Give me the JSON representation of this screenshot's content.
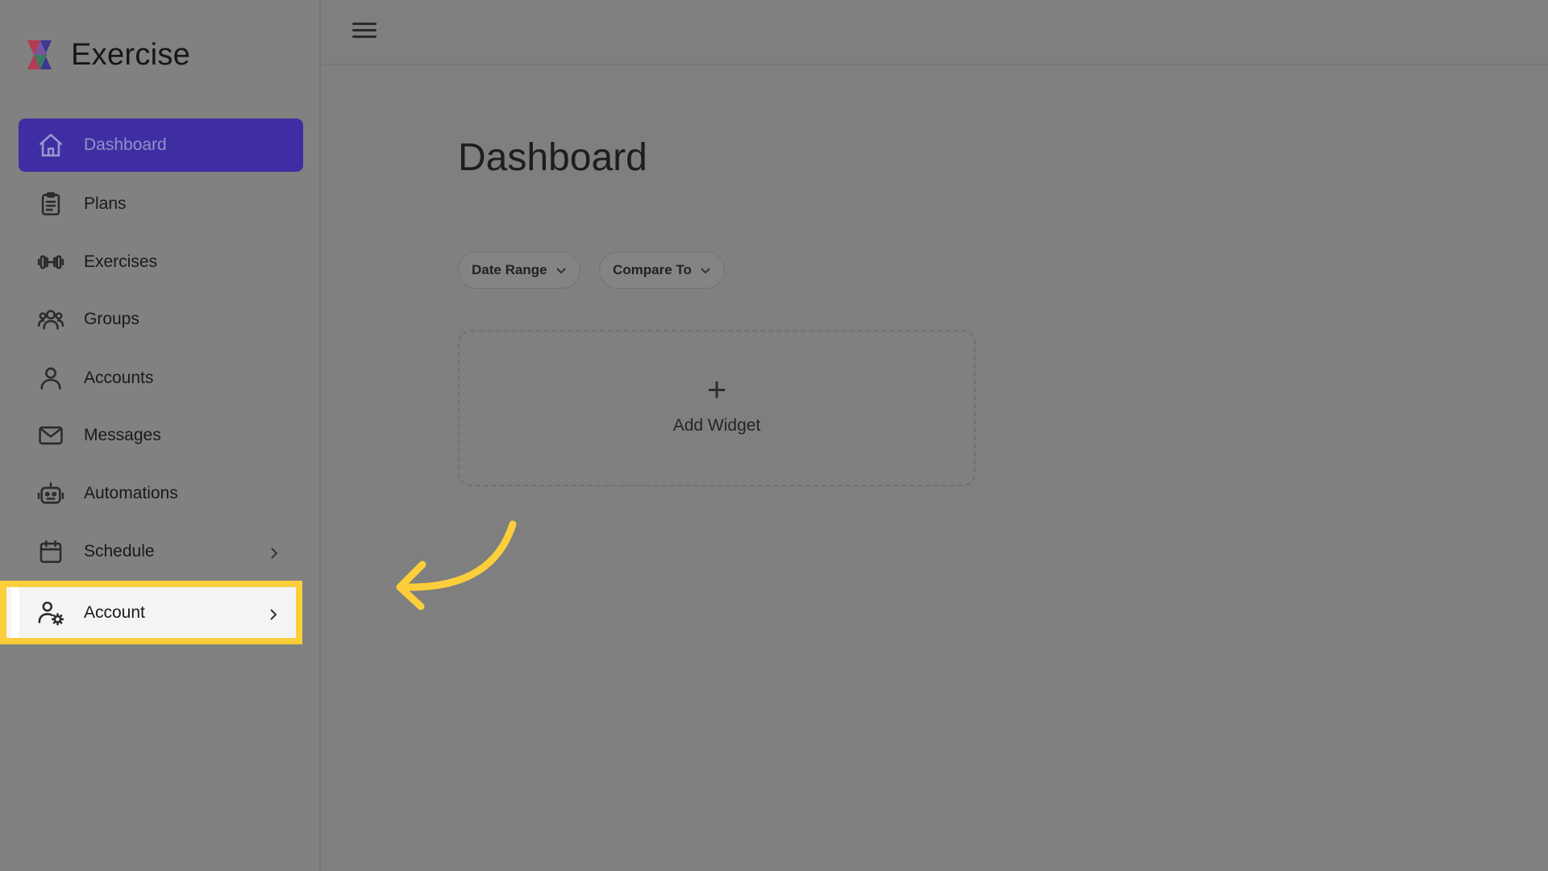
{
  "brand": {
    "name": "Exercise",
    "logo_icon": "exercise-logo"
  },
  "topbar": {
    "menu_icon": "hamburger-menu-icon"
  },
  "sidebar": {
    "items": [
      {
        "label": "Dashboard",
        "icon": "home-icon",
        "active": true
      },
      {
        "label": "Plans",
        "icon": "clipboard-icon"
      },
      {
        "label": "Exercises",
        "icon": "dumbbell-icon"
      },
      {
        "label": "Groups",
        "icon": "users-icon"
      },
      {
        "label": "Accounts",
        "icon": "user-icon"
      },
      {
        "label": "Messages",
        "icon": "mail-icon"
      },
      {
        "label": "Automations",
        "icon": "robot-icon"
      },
      {
        "label": "Schedule",
        "icon": "calendar-icon",
        "has_submenu": true
      },
      {
        "label": "Account",
        "icon": "user-settings-icon",
        "has_submenu": true,
        "highlighted": true
      }
    ]
  },
  "main": {
    "title": "Dashboard",
    "filters": {
      "date_range": "Date Range",
      "compare_to": "Compare To"
    },
    "add_widget": {
      "icon": "plus-icon",
      "label": "Add Widget"
    }
  },
  "colors": {
    "active_nav": "#3f2ea3",
    "highlight": "#fcce3b",
    "overlay": "#7e7f7e"
  }
}
